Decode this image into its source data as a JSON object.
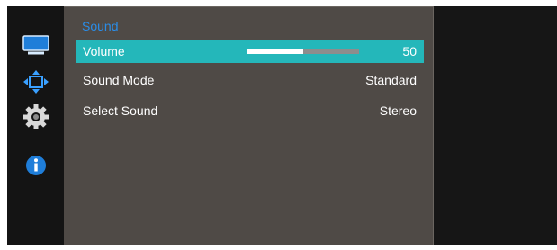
{
  "rail": {
    "icons": [
      "monitor-icon",
      "position-arrows-icon",
      "gear-icon",
      "info-icon"
    ]
  },
  "menu": {
    "title": "Sound",
    "rows": [
      {
        "label": "Volume",
        "value": "50",
        "level_percent": 50,
        "selected": true
      },
      {
        "label": "Sound Mode",
        "value": "Standard",
        "selected": false
      },
      {
        "label": "Select Sound",
        "value": "Stereo",
        "selected": false
      }
    ]
  },
  "colors": {
    "accent_blue": "#2a8de8",
    "selection_teal": "#24b7ba",
    "panel_bg": "#4f4a46",
    "rail_bg": "#141414"
  }
}
